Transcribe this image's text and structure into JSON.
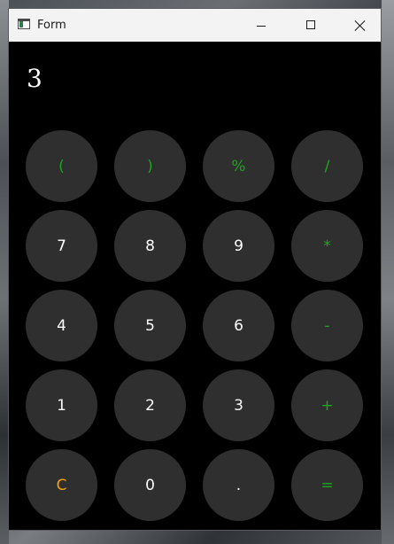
{
  "window": {
    "title": "Form"
  },
  "display": {
    "value": "3"
  },
  "colors": {
    "operator": "#1fa51f",
    "digit": "#ffffff",
    "clear": "#f0a30a",
    "key_bg": "#2f2f2f",
    "window_bg": "#000000"
  },
  "keypad": {
    "rows": [
      [
        {
          "label": "(",
          "name": "open-paren-key",
          "kind": "operator"
        },
        {
          "label": ")",
          "name": "close-paren-key",
          "kind": "operator"
        },
        {
          "label": "%",
          "name": "percent-key",
          "kind": "operator"
        },
        {
          "label": "/",
          "name": "divide-key",
          "kind": "operator"
        }
      ],
      [
        {
          "label": "7",
          "name": "digit-7-key",
          "kind": "digit"
        },
        {
          "label": "8",
          "name": "digit-8-key",
          "kind": "digit"
        },
        {
          "label": "9",
          "name": "digit-9-key",
          "kind": "digit"
        },
        {
          "label": "*",
          "name": "multiply-key",
          "kind": "operator"
        }
      ],
      [
        {
          "label": "4",
          "name": "digit-4-key",
          "kind": "digit"
        },
        {
          "label": "5",
          "name": "digit-5-key",
          "kind": "digit"
        },
        {
          "label": "6",
          "name": "digit-6-key",
          "kind": "digit"
        },
        {
          "label": "-",
          "name": "subtract-key",
          "kind": "operator"
        }
      ],
      [
        {
          "label": "1",
          "name": "digit-1-key",
          "kind": "digit"
        },
        {
          "label": "2",
          "name": "digit-2-key",
          "kind": "digit"
        },
        {
          "label": "3",
          "name": "digit-3-key",
          "kind": "digit"
        },
        {
          "label": "+",
          "name": "add-key",
          "kind": "operator"
        }
      ],
      [
        {
          "label": "C",
          "name": "clear-key",
          "kind": "clear"
        },
        {
          "label": "0",
          "name": "digit-0-key",
          "kind": "digit"
        },
        {
          "label": ".",
          "name": "decimal-point-key",
          "kind": "digit"
        },
        {
          "label": "=",
          "name": "equals-key",
          "kind": "operator"
        }
      ]
    ]
  }
}
